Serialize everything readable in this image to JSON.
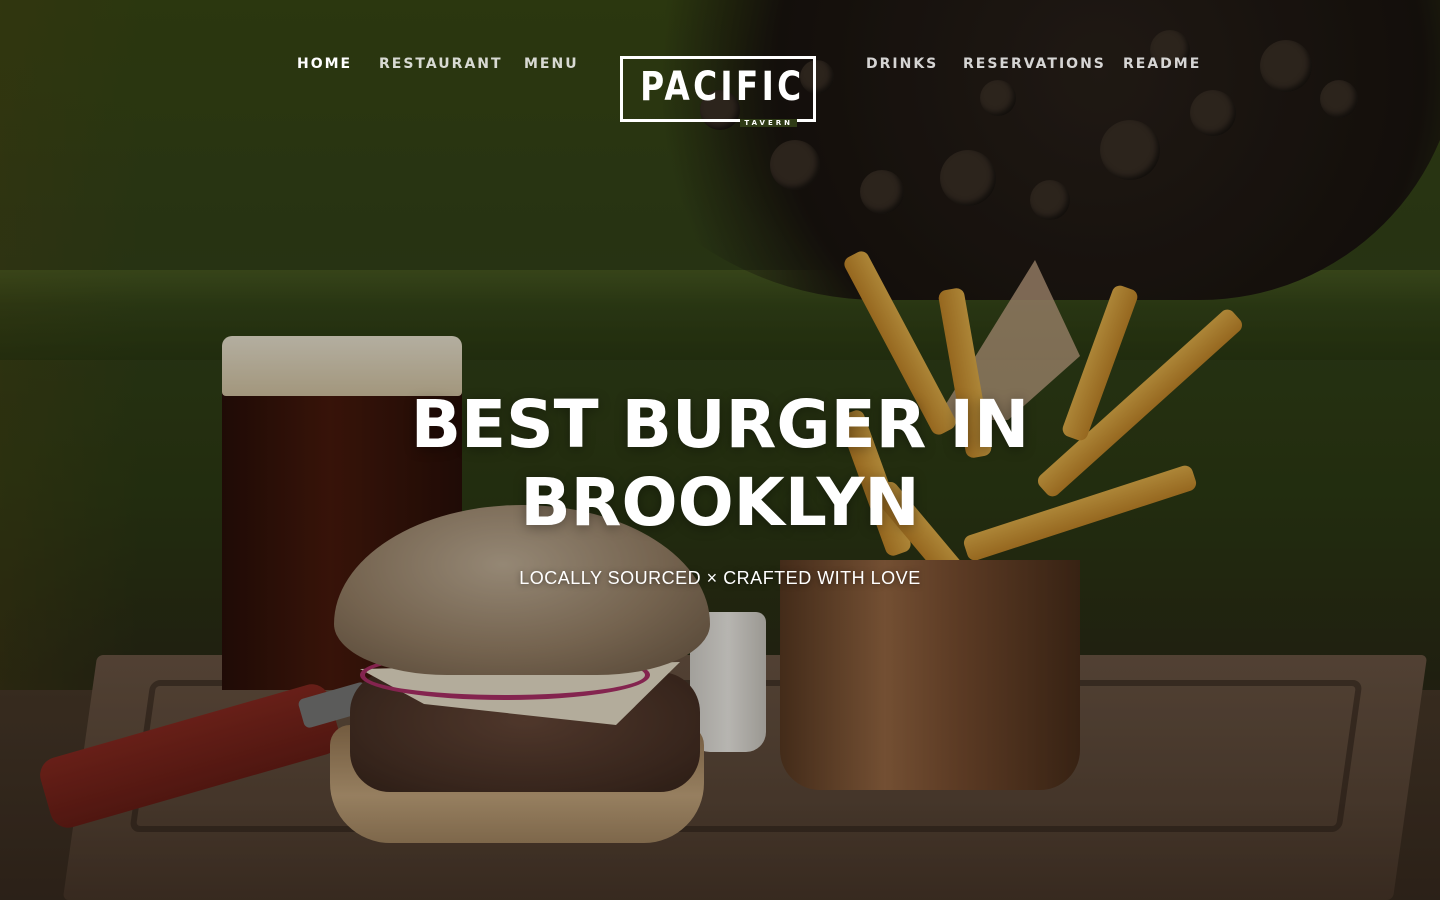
{
  "nav": {
    "left_items": [
      {
        "label": "HOME",
        "active": true
      },
      {
        "label": "RESTAURANT",
        "active": false
      },
      {
        "label": "MENU",
        "active": false
      }
    ],
    "right_items": [
      {
        "label": "DRINKS",
        "active": false
      },
      {
        "label": "RESERVATIONS",
        "active": false
      },
      {
        "label": "README",
        "active": false
      }
    ],
    "logo": {
      "name": "PACIFIC",
      "subtitle": "TAVERN"
    }
  },
  "hero": {
    "headline_line1": "BEST BURGER IN",
    "headline_line2": "BROOKLYN",
    "tagline": "LOCALLY SOURCED × CRAFTED WITH LOVE",
    "background_image": "burger-fries-beer-photo"
  },
  "colors": {
    "text": "#ffffff",
    "wall_green": "#34441a",
    "wood": "#5c4838"
  }
}
